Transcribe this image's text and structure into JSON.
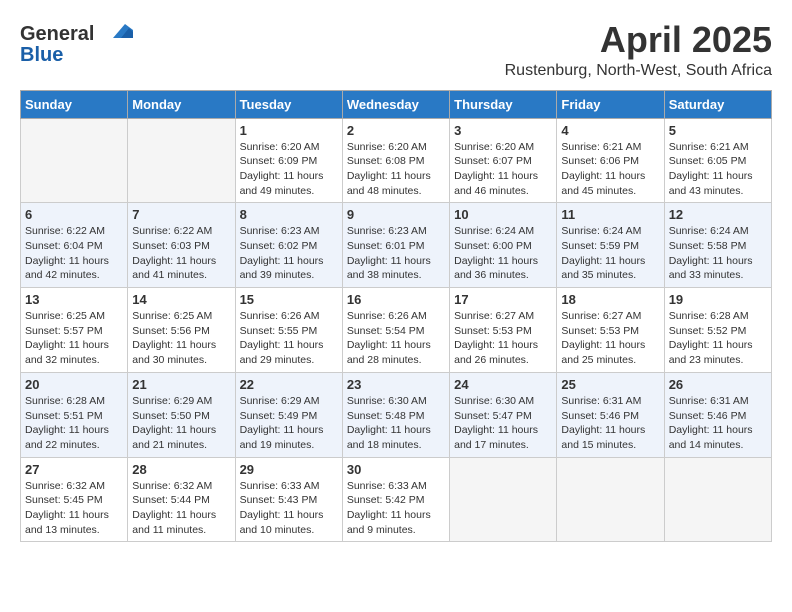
{
  "header": {
    "logo_general": "General",
    "logo_blue": "Blue",
    "month": "April 2025",
    "location": "Rustenburg, North-West, South Africa"
  },
  "weekdays": [
    "Sunday",
    "Monday",
    "Tuesday",
    "Wednesday",
    "Thursday",
    "Friday",
    "Saturday"
  ],
  "weeks": [
    [
      {
        "day": "",
        "info": ""
      },
      {
        "day": "",
        "info": ""
      },
      {
        "day": "1",
        "info": "Sunrise: 6:20 AM\nSunset: 6:09 PM\nDaylight: 11 hours and 49 minutes."
      },
      {
        "day": "2",
        "info": "Sunrise: 6:20 AM\nSunset: 6:08 PM\nDaylight: 11 hours and 48 minutes."
      },
      {
        "day": "3",
        "info": "Sunrise: 6:20 AM\nSunset: 6:07 PM\nDaylight: 11 hours and 46 minutes."
      },
      {
        "day": "4",
        "info": "Sunrise: 6:21 AM\nSunset: 6:06 PM\nDaylight: 11 hours and 45 minutes."
      },
      {
        "day": "5",
        "info": "Sunrise: 6:21 AM\nSunset: 6:05 PM\nDaylight: 11 hours and 43 minutes."
      }
    ],
    [
      {
        "day": "6",
        "info": "Sunrise: 6:22 AM\nSunset: 6:04 PM\nDaylight: 11 hours and 42 minutes."
      },
      {
        "day": "7",
        "info": "Sunrise: 6:22 AM\nSunset: 6:03 PM\nDaylight: 11 hours and 41 minutes."
      },
      {
        "day": "8",
        "info": "Sunrise: 6:23 AM\nSunset: 6:02 PM\nDaylight: 11 hours and 39 minutes."
      },
      {
        "day": "9",
        "info": "Sunrise: 6:23 AM\nSunset: 6:01 PM\nDaylight: 11 hours and 38 minutes."
      },
      {
        "day": "10",
        "info": "Sunrise: 6:24 AM\nSunset: 6:00 PM\nDaylight: 11 hours and 36 minutes."
      },
      {
        "day": "11",
        "info": "Sunrise: 6:24 AM\nSunset: 5:59 PM\nDaylight: 11 hours and 35 minutes."
      },
      {
        "day": "12",
        "info": "Sunrise: 6:24 AM\nSunset: 5:58 PM\nDaylight: 11 hours and 33 minutes."
      }
    ],
    [
      {
        "day": "13",
        "info": "Sunrise: 6:25 AM\nSunset: 5:57 PM\nDaylight: 11 hours and 32 minutes."
      },
      {
        "day": "14",
        "info": "Sunrise: 6:25 AM\nSunset: 5:56 PM\nDaylight: 11 hours and 30 minutes."
      },
      {
        "day": "15",
        "info": "Sunrise: 6:26 AM\nSunset: 5:55 PM\nDaylight: 11 hours and 29 minutes."
      },
      {
        "day": "16",
        "info": "Sunrise: 6:26 AM\nSunset: 5:54 PM\nDaylight: 11 hours and 28 minutes."
      },
      {
        "day": "17",
        "info": "Sunrise: 6:27 AM\nSunset: 5:53 PM\nDaylight: 11 hours and 26 minutes."
      },
      {
        "day": "18",
        "info": "Sunrise: 6:27 AM\nSunset: 5:53 PM\nDaylight: 11 hours and 25 minutes."
      },
      {
        "day": "19",
        "info": "Sunrise: 6:28 AM\nSunset: 5:52 PM\nDaylight: 11 hours and 23 minutes."
      }
    ],
    [
      {
        "day": "20",
        "info": "Sunrise: 6:28 AM\nSunset: 5:51 PM\nDaylight: 11 hours and 22 minutes."
      },
      {
        "day": "21",
        "info": "Sunrise: 6:29 AM\nSunset: 5:50 PM\nDaylight: 11 hours and 21 minutes."
      },
      {
        "day": "22",
        "info": "Sunrise: 6:29 AM\nSunset: 5:49 PM\nDaylight: 11 hours and 19 minutes."
      },
      {
        "day": "23",
        "info": "Sunrise: 6:30 AM\nSunset: 5:48 PM\nDaylight: 11 hours and 18 minutes."
      },
      {
        "day": "24",
        "info": "Sunrise: 6:30 AM\nSunset: 5:47 PM\nDaylight: 11 hours and 17 minutes."
      },
      {
        "day": "25",
        "info": "Sunrise: 6:31 AM\nSunset: 5:46 PM\nDaylight: 11 hours and 15 minutes."
      },
      {
        "day": "26",
        "info": "Sunrise: 6:31 AM\nSunset: 5:46 PM\nDaylight: 11 hours and 14 minutes."
      }
    ],
    [
      {
        "day": "27",
        "info": "Sunrise: 6:32 AM\nSunset: 5:45 PM\nDaylight: 11 hours and 13 minutes."
      },
      {
        "day": "28",
        "info": "Sunrise: 6:32 AM\nSunset: 5:44 PM\nDaylight: 11 hours and 11 minutes."
      },
      {
        "day": "29",
        "info": "Sunrise: 6:33 AM\nSunset: 5:43 PM\nDaylight: 11 hours and 10 minutes."
      },
      {
        "day": "30",
        "info": "Sunrise: 6:33 AM\nSunset: 5:42 PM\nDaylight: 11 hours and 9 minutes."
      },
      {
        "day": "",
        "info": ""
      },
      {
        "day": "",
        "info": ""
      },
      {
        "day": "",
        "info": ""
      }
    ]
  ]
}
